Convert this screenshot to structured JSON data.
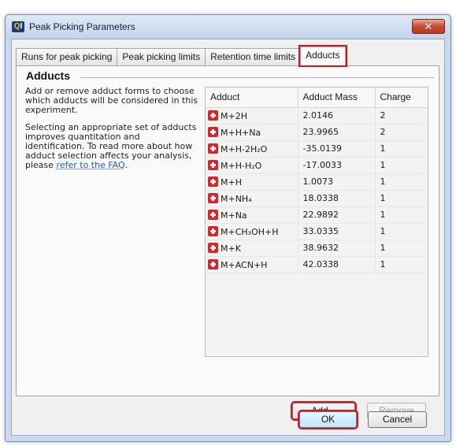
{
  "window": {
    "title": "Peak Picking Parameters",
    "app_icon_text": "Q",
    "app_icon_text2": "I",
    "close_glyph": "✕"
  },
  "tabs": [
    {
      "label": "Runs for peak picking",
      "active": false
    },
    {
      "label": "Peak picking limits",
      "active": false
    },
    {
      "label": "Retention time limits",
      "active": false
    },
    {
      "label": "Adducts",
      "active": true
    }
  ],
  "panel": {
    "group_title": "Adducts",
    "description1": "Add or remove adduct forms to choose which adducts will be considered in this experiment.",
    "description2": "Selecting an appropriate set of adducts improves quantitation and identification. To read more about how adduct selection affects your analysis, please ",
    "faq_link": "refer to the FAQ",
    "description2_end": "."
  },
  "table": {
    "headers": [
      "Adduct",
      "Adduct Mass",
      "Charge"
    ],
    "rows": [
      {
        "adduct": "M+2H",
        "mass": "2.0146",
        "charge": "2"
      },
      {
        "adduct": "M+H+Na",
        "mass": "23.9965",
        "charge": "2"
      },
      {
        "adduct": "M+H-2H₂O",
        "mass": "-35.0139",
        "charge": "1"
      },
      {
        "adduct": "M+H-H₂O",
        "mass": "-17.0033",
        "charge": "1"
      },
      {
        "adduct": "M+H",
        "mass": "1.0073",
        "charge": "1"
      },
      {
        "adduct": "M+NH₄",
        "mass": "18.0338",
        "charge": "1"
      },
      {
        "adduct": "M+Na",
        "mass": "22.9892",
        "charge": "1"
      },
      {
        "adduct": "M+CH₃OH+H",
        "mass": "33.0335",
        "charge": "1"
      },
      {
        "adduct": "M+K",
        "mass": "38.9632",
        "charge": "1"
      },
      {
        "adduct": "M+ACN+H",
        "mass": "42.0338",
        "charge": "1"
      }
    ]
  },
  "buttons": {
    "add": "Add...",
    "remove": "Remove",
    "ok": "OK",
    "cancel": "Cancel"
  },
  "colors": {
    "highlight": "#e0141a",
    "add_icon": "#d8262d",
    "link": "#1e5bc6"
  }
}
